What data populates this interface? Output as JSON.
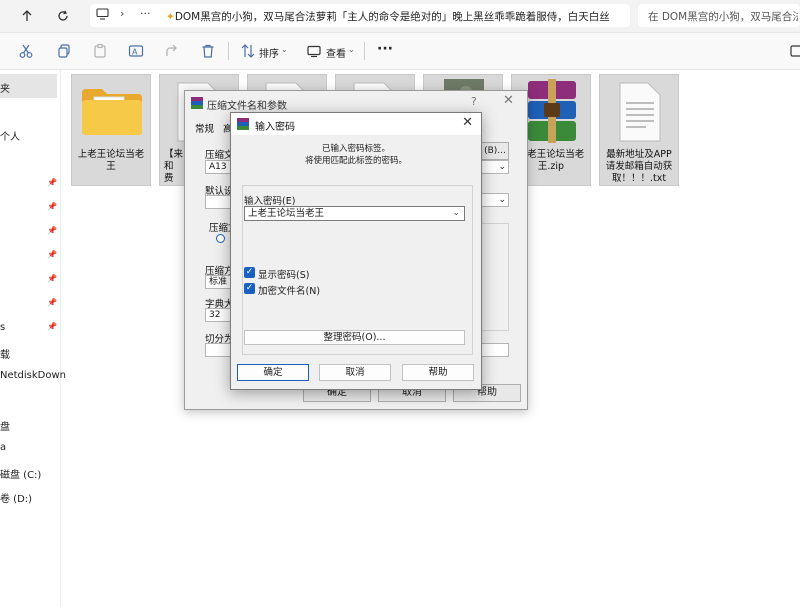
{
  "address_bar": {
    "path": "DOM黑宫的小狗，双马尾合法萝莉「主人的命令是绝对的」晚上黑丝乖乖跪着服侍，白天白丝",
    "search": "在 DOM黑宫的小狗，双马尾合法萝莉"
  },
  "toolbar": {
    "sort_label": "排序",
    "view_label": "查看"
  },
  "sidebar": {
    "items": [
      "夹",
      "个人",
      "",
      "",
      "",
      "",
      "",
      "",
      "",
      "载",
      "NetdiskDown",
      "盘",
      "",
      "磁盘 (C:)",
      "卷 (D:)"
    ]
  },
  "files": [
    {
      "name": "上老王论坛当老王",
      "type": "folder"
    },
    {
      "name": "【来\n和\n费",
      "type": "doc"
    },
    {
      "name": "",
      "type": "doc"
    },
    {
      "name": "",
      "type": "doc"
    },
    {
      "name": "",
      "type": "image"
    },
    {
      "name": "上老王论坛当老王.zip",
      "type": "zip"
    },
    {
      "name": "最新地址及APP请发邮箱自动获取！！！.txt",
      "type": "txt"
    }
  ],
  "back_dialog": {
    "title": "压缩文件名和参数",
    "tab_general": "常规",
    "tab_advanced": "高",
    "archive_label": "压缩文",
    "archive_value": "A13",
    "browse_label": "(B)...",
    "default_label": "默认设",
    "format_label": "压缩文",
    "method_label": "压缩方",
    "method_value": "标准",
    "dict_label": "字典大",
    "dict_value": "32",
    "split_label": "切分为",
    "ok": "确定",
    "cancel": "取消",
    "help": "帮助"
  },
  "password_dialog": {
    "title": "输入密码",
    "info_line1": "已输入密码标签。",
    "info_line2": "将使用匹配此标签的密码。",
    "password_label": "输入密码(E)",
    "password_value": "上老王论坛当老王",
    "show_password": "显示密码(S)",
    "encrypt_names": "加密文件名(N)",
    "organize_button": "整理密码(O)...",
    "ok": "确定",
    "cancel": "取消",
    "help": "帮助"
  },
  "colors": {
    "accent": "#1a5fc4",
    "folder": "#f5c242",
    "selection": "#d9d9d9"
  }
}
